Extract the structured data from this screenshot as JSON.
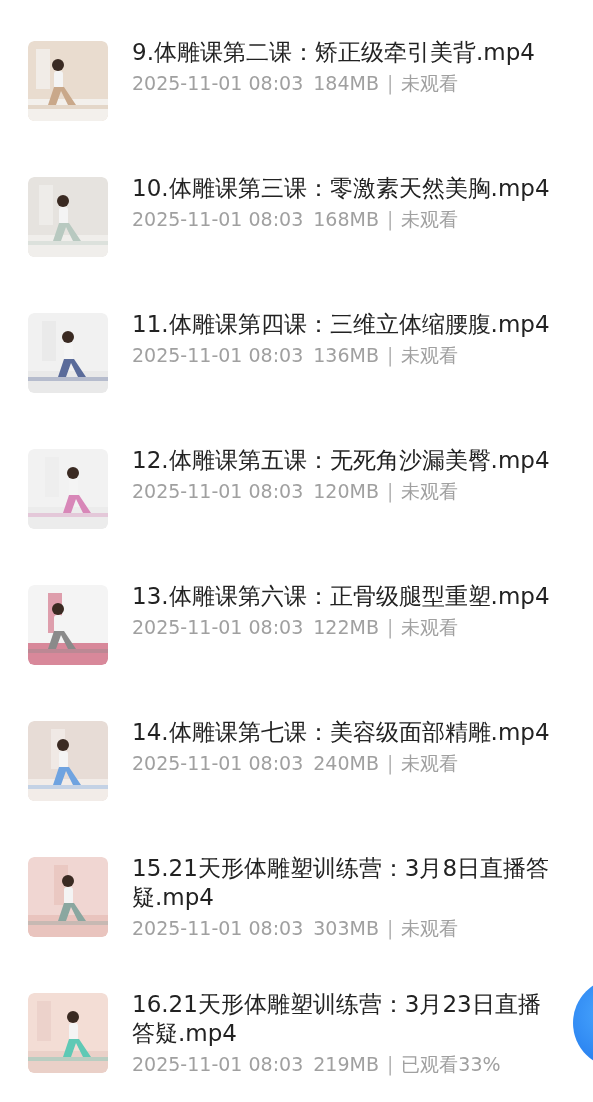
{
  "files": [
    {
      "title": "9.体雕课第二课：矫正级牵引美背.mp4",
      "date": "2025-11-01 08:03",
      "size": "184MB",
      "separator": "|",
      "status": "未观看"
    },
    {
      "title": "10.体雕课第三课：零激素天然美胸.mp4",
      "date": "2025-11-01 08:03",
      "size": "168MB",
      "separator": "|",
      "status": "未观看"
    },
    {
      "title": "11.体雕课第四课：三维立体缩腰腹.mp4",
      "date": "2025-11-01 08:03",
      "size": "136MB",
      "separator": "|",
      "status": "未观看"
    },
    {
      "title": "12.体雕课第五课：无死角沙漏美臀.mp4",
      "date": "2025-11-01 08:03",
      "size": "120MB",
      "separator": "|",
      "status": "未观看"
    },
    {
      "title": "13.体雕课第六课：正骨级腿型重塑.mp4",
      "date": "2025-11-01 08:03",
      "size": "122MB",
      "separator": "|",
      "status": "未观看"
    },
    {
      "title": "14.体雕课第七课：美容级面部精雕.mp4",
      "date": "2025-11-01 08:03",
      "size": "240MB",
      "separator": "|",
      "status": "未观看"
    },
    {
      "title": "15.21天形体雕塑训练营：3月8日直播答疑.mp4",
      "date": "2025-11-01 08:03",
      "size": "303MB",
      "separator": "|",
      "status": "未观看"
    },
    {
      "title": "16.21天形体雕塑训练营：3月23日直播答疑.mp4",
      "date": "2025-11-01 08:03",
      "size": "219MB",
      "separator": "|",
      "status": "已观看33%"
    }
  ]
}
